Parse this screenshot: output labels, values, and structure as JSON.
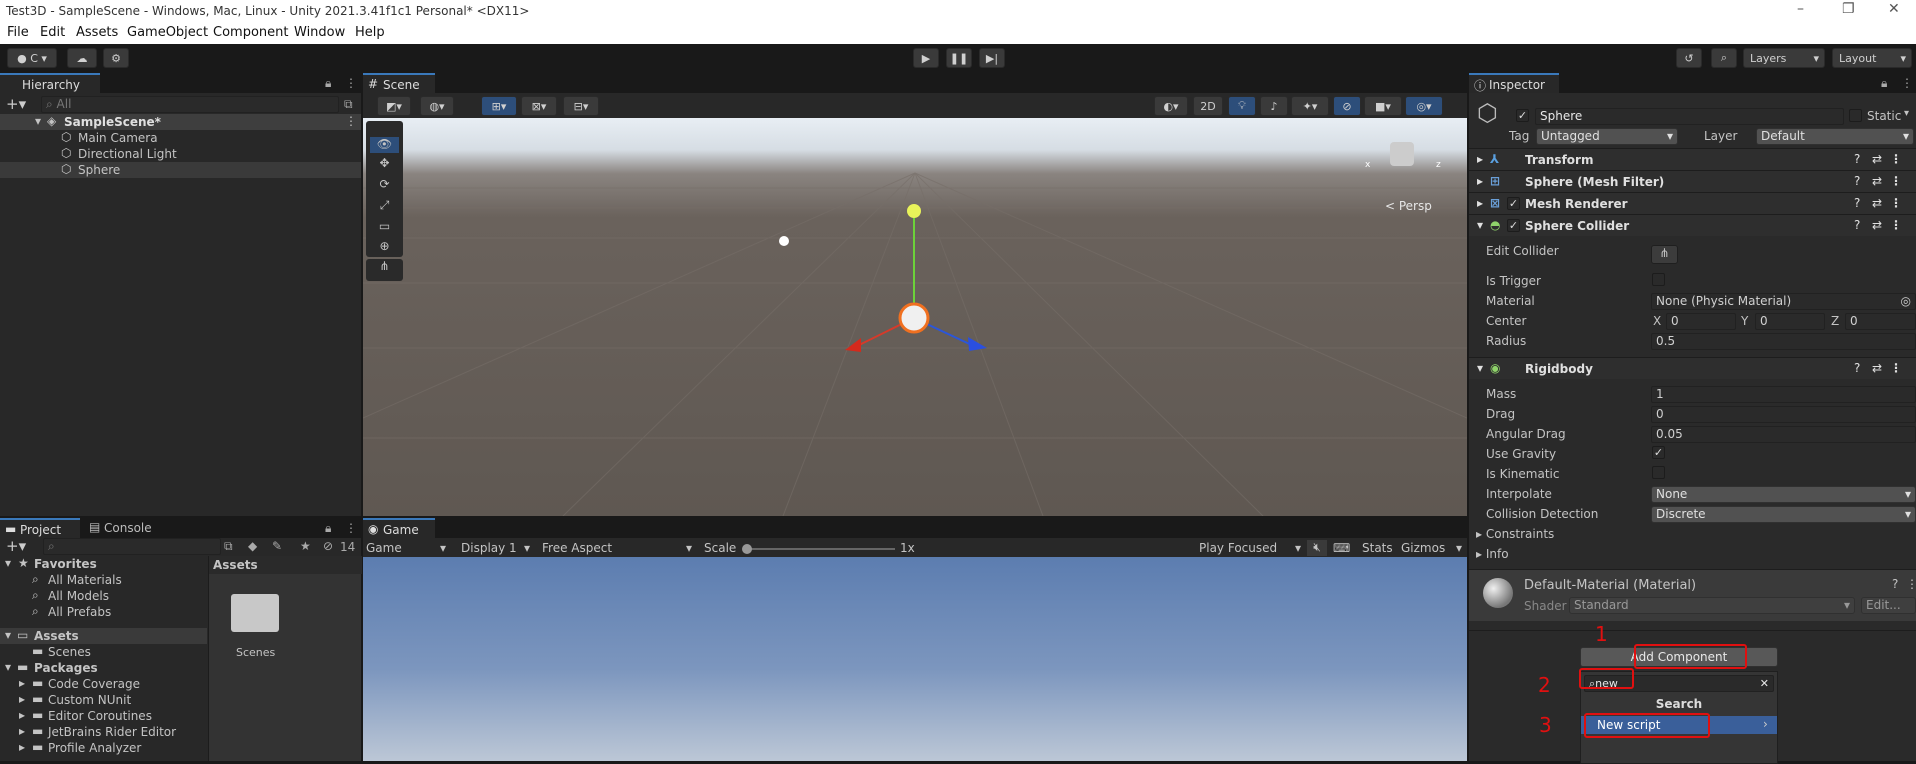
{
  "window": {
    "title": "Test3D - SampleScene - Windows, Mac, Linux - Unity 2021.3.41f1c1 Personal* <DX11>"
  },
  "menu": [
    "File",
    "Edit",
    "Assets",
    "GameObject",
    "Component",
    "Window",
    "Help"
  ],
  "toolbar": {
    "account": "C",
    "layers": "Layers",
    "layout": "Layout"
  },
  "hierarchy": {
    "tab": "Hierarchy",
    "search_placeholder": "All",
    "scene": "SampleScene*",
    "items": [
      "Main Camera",
      "Directional Light",
      "Sphere"
    ]
  },
  "scene": {
    "tab": "Scene",
    "mode_2d": "2D",
    "persp": "< Persp",
    "gizmo_x": "x",
    "gizmo_z": "z"
  },
  "project": {
    "tab": "Project",
    "console_tab": "Console",
    "hidden_count": "14",
    "favorites": "Favorites",
    "fav_items": [
      "All Materials",
      "All Models",
      "All Prefabs"
    ],
    "assets": "Assets",
    "asset_children": [
      "Scenes"
    ],
    "packages": "Packages",
    "package_items": [
      "Code Coverage",
      "Custom NUnit",
      "Editor Coroutines",
      "JetBrains Rider Editor",
      "Profile Analyzer"
    ],
    "assets_header": "Assets",
    "folder": "Scenes"
  },
  "game": {
    "tab": "Game",
    "view": "Game",
    "display": "Display 1",
    "aspect": "Free Aspect",
    "scale_label": "Scale",
    "scale_value": "1x",
    "play_focused": "Play Focused",
    "stats": "Stats",
    "gizmos": "Gizmos"
  },
  "inspector": {
    "tab": "Inspector",
    "name": "Sphere",
    "static": "Static",
    "tag_label": "Tag",
    "tag": "Untagged",
    "layer_label": "Layer",
    "layer": "Default",
    "components": [
      "Transform",
      "Sphere (Mesh Filter)",
      "Mesh Renderer",
      "Sphere Collider"
    ],
    "collider": {
      "edit": "Edit Collider",
      "is_trigger": "Is Trigger",
      "material_label": "Material",
      "material": "None (Physic Material)",
      "center": "Center",
      "x": "0",
      "y": "0",
      "z": "0",
      "radius_label": "Radius",
      "radius": "0.5"
    },
    "rigidbody": {
      "title": "Rigidbody",
      "mass_label": "Mass",
      "mass": "1",
      "drag_label": "Drag",
      "drag": "0",
      "angular_label": "Angular Drag",
      "angular": "0.05",
      "gravity_label": "Use Gravity",
      "kinematic_label": "Is Kinematic",
      "interp_label": "Interpolate",
      "interp": "None",
      "collision_label": "Collision Detection",
      "collision": "Discrete",
      "constraints": "Constraints",
      "info": "Info"
    },
    "material": {
      "name": "Default-Material (Material)",
      "shader_label": "Shader",
      "shader": "Standard",
      "edit": "Edit..."
    },
    "add_component": "Add Component",
    "search_value": "new",
    "search_header": "Search",
    "new_script": "New script",
    "annotations": [
      "1",
      "2",
      "3"
    ]
  }
}
